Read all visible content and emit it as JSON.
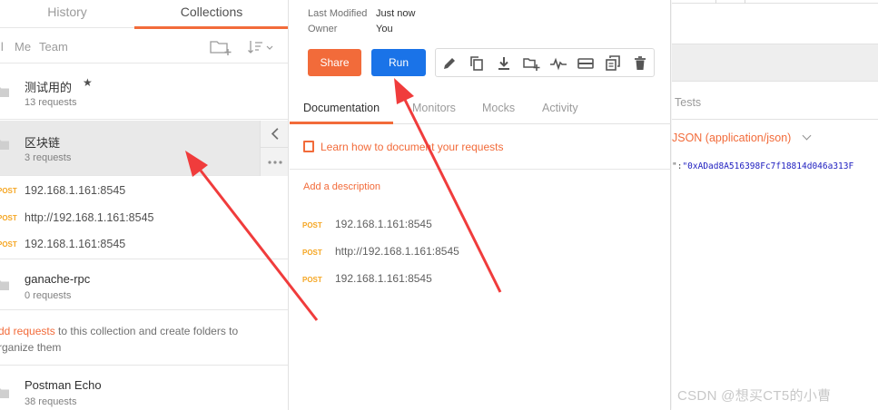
{
  "sidebar": {
    "tabs": {
      "history": "History",
      "collections": "Collections"
    },
    "filters": {
      "all": "ll",
      "me": "Me",
      "team": "Team"
    },
    "collections": [
      {
        "name": "测试用的",
        "count": "13 requests",
        "starred": true
      },
      {
        "name": "区块链",
        "count": "3 requests"
      },
      {
        "name": "ganache-rpc",
        "count": "0 requests"
      },
      {
        "name": "Postman Echo",
        "count": "38 requests"
      }
    ],
    "requests": [
      {
        "method": "POST",
        "url": "192.168.1.161:8545"
      },
      {
        "method": "POST",
        "url": "http://192.168.1.161:8545"
      },
      {
        "method": "POST",
        "url": "192.168.1.161:8545"
      }
    ],
    "hint": {
      "link": "dd requests",
      "text": " to this collection and create folders to",
      "text2": "rganize them"
    }
  },
  "panel": {
    "meta": {
      "last_modified_label": "Last Modified",
      "last_modified_value": "Just now",
      "owner_label": "Owner",
      "owner_value": "You"
    },
    "buttons": {
      "share": "Share",
      "run": "Run"
    },
    "tabs": {
      "documentation": "Documentation",
      "monitors": "Monitors",
      "mocks": "Mocks",
      "activity": "Activity"
    },
    "learn": "Learn how to document your requests",
    "add_description": "Add a description",
    "requests": [
      {
        "method": "POST",
        "url": "192.168.1.161:8545"
      },
      {
        "method": "POST",
        "url": "http://192.168.1.161:8545"
      },
      {
        "method": "POST",
        "url": "192.168.1.161:8545"
      }
    ]
  },
  "right": {
    "tab": "Tests",
    "body_type": "JSON (application/json)",
    "code_key": "\":",
    "code_value": "\"0xADad8A516398Fc7f18814d046a313F",
    "watermark": "CSDN @想买CT5的小曹"
  },
  "colors": {
    "accent": "#f26b3a",
    "run": "#1a73e8",
    "method": "#f5a623",
    "arrow": "#f03c3c"
  },
  "icons": [
    "folder-icon",
    "new-folder-icon",
    "sort-icon",
    "star-icon",
    "chevron-left-icon",
    "more-icon",
    "edit-icon",
    "duplicate-icon",
    "download-icon",
    "add-folder-icon",
    "monitor-icon",
    "mock-icon",
    "copy-icon",
    "delete-icon",
    "book-icon",
    "chevron-down-icon"
  ]
}
